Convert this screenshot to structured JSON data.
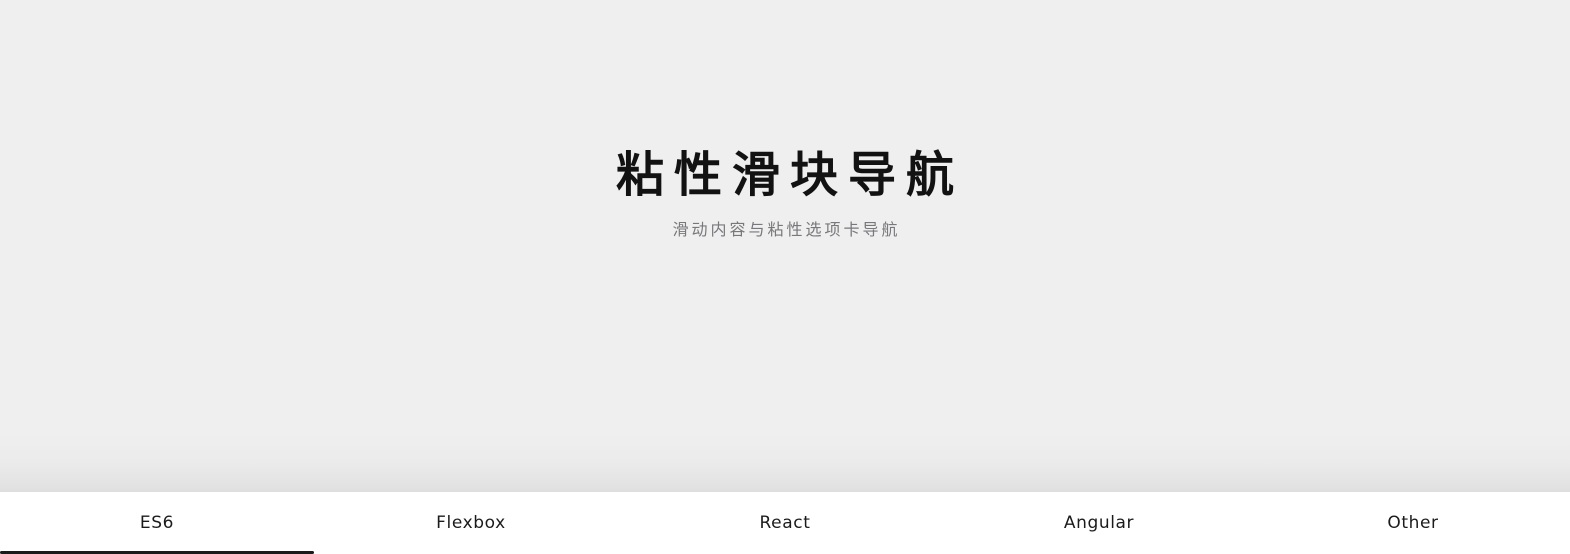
{
  "hero": {
    "title": "粘性滑块导航",
    "subtitle": "滑动内容与粘性选项卡导航",
    "background_color": "#efefef",
    "title_color": "#121212",
    "subtitle_color": "#78787c"
  },
  "tabnav": {
    "background_color": "#ffffff",
    "text_color": "#1b1b1b",
    "indicator_color": "#1b1b1b",
    "active_index": 0,
    "tabs": [
      {
        "label": "ES6"
      },
      {
        "label": "Flexbox"
      },
      {
        "label": "React"
      },
      {
        "label": "Angular"
      },
      {
        "label": "Other"
      }
    ]
  }
}
